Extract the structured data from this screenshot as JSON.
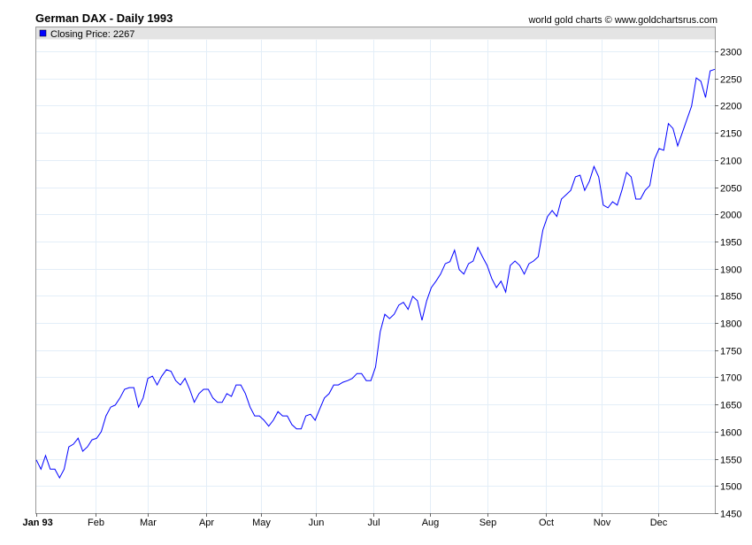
{
  "chart_data": {
    "type": "line",
    "title": "German DAX - Daily 1993",
    "credit": "world gold charts © www.goldchartsrus.com",
    "legend": {
      "label": "Closing Price: 2267",
      "placement": "top-left",
      "color": "#0000ff"
    },
    "xlabel": "",
    "ylabel": "",
    "ylim": [
      1450,
      2300
    ],
    "y_ticks": [
      1450,
      1500,
      1550,
      1600,
      1650,
      1700,
      1750,
      1800,
      1850,
      1900,
      1950,
      2000,
      2050,
      2100,
      2150,
      2200,
      2250,
      2300
    ],
    "x_tick_labels": [
      "Jan 93",
      "Feb",
      "Mar",
      "Apr",
      "May",
      "Jun",
      "Jul",
      "Aug",
      "Sep",
      "Oct",
      "Nov",
      "Dec"
    ],
    "x_tick_months": [
      0,
      1,
      2,
      3,
      4,
      5,
      6,
      7,
      8,
      9,
      10,
      11
    ],
    "grid": true,
    "series": [
      {
        "name": "Closing Price",
        "color": "#0000ff",
        "values": [
          1548,
          1531,
          1556,
          1531,
          1531,
          1515,
          1531,
          1572,
          1577,
          1588,
          1564,
          1572,
          1585,
          1588,
          1600,
          1629,
          1645,
          1649,
          1662,
          1678,
          1681,
          1681,
          1645,
          1662,
          1698,
          1702,
          1686,
          1702,
          1714,
          1711,
          1694,
          1686,
          1698,
          1678,
          1654,
          1670,
          1678,
          1678,
          1662,
          1654,
          1654,
          1670,
          1665,
          1686,
          1686,
          1670,
          1645,
          1629,
          1629,
          1621,
          1610,
          1621,
          1637,
          1629,
          1629,
          1613,
          1605,
          1605,
          1629,
          1632,
          1621,
          1642,
          1662,
          1670,
          1686,
          1686,
          1691,
          1694,
          1698,
          1707,
          1707,
          1694,
          1694,
          1719,
          1784,
          1816,
          1808,
          1816,
          1833,
          1838,
          1825,
          1849,
          1841,
          1805,
          1841,
          1865,
          1877,
          1890,
          1909,
          1913,
          1934,
          1898,
          1890,
          1909,
          1914,
          1939,
          1922,
          1906,
          1882,
          1865,
          1877,
          1857,
          1906,
          1914,
          1906,
          1890,
          1909,
          1914,
          1922,
          1971,
          1996,
          2007,
          1996,
          2028,
          2036,
          2044,
          2069,
          2072,
          2044,
          2061,
          2088,
          2069,
          2017,
          2012,
          2023,
          2017,
          2044,
          2077,
          2069,
          2028,
          2028,
          2044,
          2053,
          2101,
          2121,
          2118,
          2167,
          2158,
          2126,
          2150,
          2175,
          2199,
          2251,
          2245,
          2215,
          2264,
          2267
        ]
      }
    ]
  }
}
